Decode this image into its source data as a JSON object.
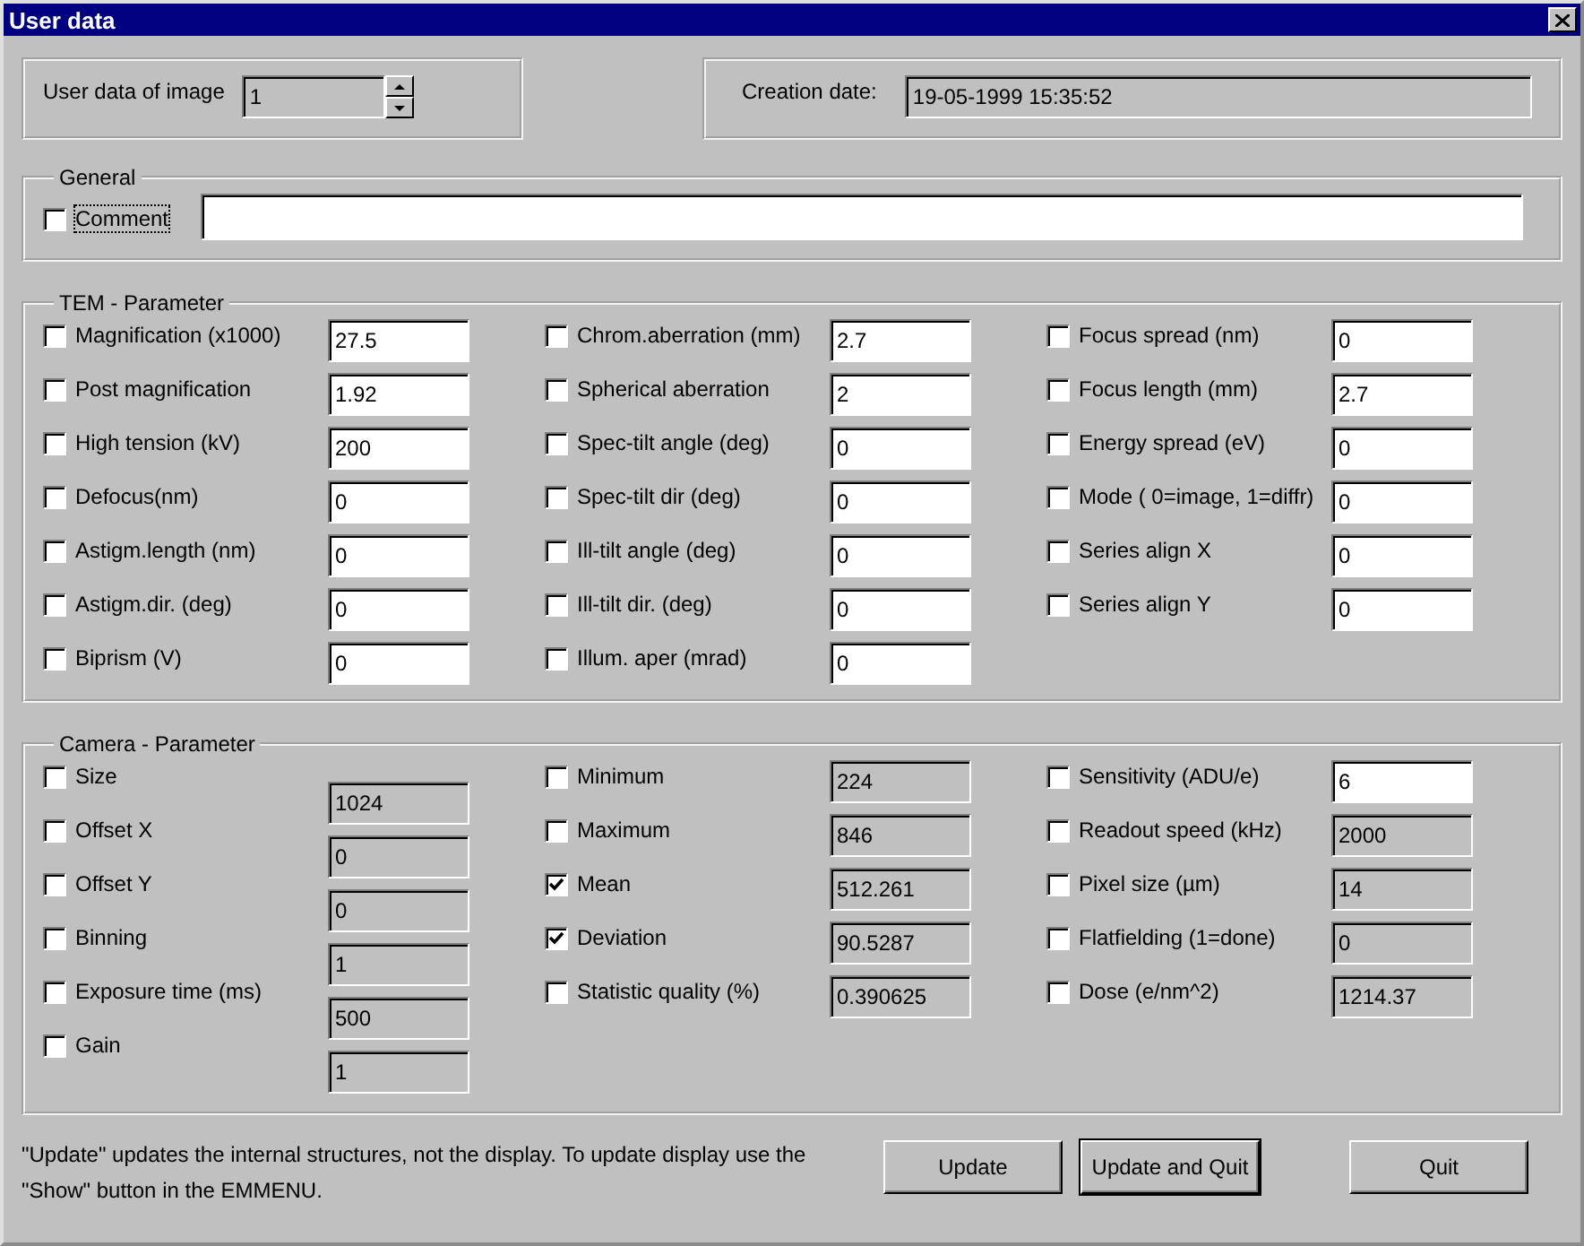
{
  "window": {
    "title": "User data"
  },
  "image_selector": {
    "label": "User data of image",
    "value": "1"
  },
  "creation": {
    "label": "Creation date:",
    "value": "19-05-1999 15:35:52"
  },
  "general": {
    "title": "General",
    "comment": {
      "label": "Comment",
      "checked": false,
      "focused": true
    }
  },
  "sections": [
    {
      "title": "TEM - Parameter",
      "columns": [
        [
          {
            "label": "Magnification (x1000)",
            "checked": false,
            "value": "27.5",
            "disabled": false
          },
          {
            "label": "Post magnification",
            "checked": false,
            "value": "1.92",
            "disabled": false
          },
          {
            "label": "High tension (kV)",
            "checked": false,
            "value": "200",
            "disabled": false
          },
          {
            "label": "Defocus(nm)",
            "checked": false,
            "value": "0",
            "disabled": false
          },
          {
            "label": "Astigm.length (nm)",
            "checked": false,
            "value": "0",
            "disabled": false
          },
          {
            "label": "Astigm.dir. (deg)",
            "checked": false,
            "value": "0",
            "disabled": false
          },
          {
            "label": "Biprism (V)",
            "checked": false,
            "value": "0",
            "disabled": false
          }
        ],
        [
          {
            "label": "Chrom.aberration (mm)",
            "checked": false,
            "value": "2.7",
            "disabled": false
          },
          {
            "label": "Spherical aberration",
            "checked": false,
            "value": "2",
            "disabled": false
          },
          {
            "label": "Spec-tilt angle (deg)",
            "checked": false,
            "value": "0",
            "disabled": false
          },
          {
            "label": "Spec-tilt dir (deg)",
            "checked": false,
            "value": "0",
            "disabled": false
          },
          {
            "label": "Ill-tilt angle (deg)",
            "checked": false,
            "value": "0",
            "disabled": false
          },
          {
            "label": "Ill-tilt dir. (deg)",
            "checked": false,
            "value": "0",
            "disabled": false
          },
          {
            "label": "Illum. aper (mrad)",
            "checked": false,
            "value": "0",
            "disabled": false
          }
        ],
        [
          {
            "label": "Focus spread (nm)",
            "checked": false,
            "value": "0",
            "disabled": false
          },
          {
            "label": "Focus length (mm)",
            "checked": false,
            "value": "2.7",
            "disabled": false
          },
          {
            "label": "Energy spread (eV)",
            "checked": false,
            "value": "0",
            "disabled": false
          },
          {
            "label": "Mode ( 0=image, 1=diffr)",
            "checked": false,
            "value": "0",
            "disabled": false
          },
          {
            "label": "Series align X",
            "checked": false,
            "value": "0",
            "disabled": false
          },
          {
            "label": "Series align Y",
            "checked": false,
            "value": "0",
            "disabled": false
          }
        ]
      ]
    },
    {
      "title": "Camera - Parameter",
      "columns": [
        [
          {
            "label": "Size",
            "checked": false,
            "value": "1024",
            "disabled": true
          },
          {
            "label": "Offset X",
            "checked": false,
            "value": "0",
            "disabled": true
          },
          {
            "label": "Offset Y",
            "checked": false,
            "value": "0",
            "disabled": true
          },
          {
            "label": "Binning",
            "checked": false,
            "value": "1",
            "disabled": true
          },
          {
            "label": "Exposure time (ms)",
            "checked": false,
            "value": "500",
            "disabled": true
          },
          {
            "label": "Gain",
            "checked": false,
            "value": "1",
            "disabled": true
          }
        ],
        [
          {
            "label": "Minimum",
            "checked": false,
            "value": "224",
            "disabled": true
          },
          {
            "label": "Maximum",
            "checked": false,
            "value": "846",
            "disabled": true
          },
          {
            "label": "Mean",
            "checked": true,
            "value": "512.261",
            "disabled": true
          },
          {
            "label": "Deviation",
            "checked": true,
            "value": "90.5287",
            "disabled": true
          },
          {
            "label": "Statistic quality (%)",
            "checked": false,
            "value": "0.390625",
            "disabled": true
          }
        ],
        [
          {
            "label": "Sensitivity (ADU/e)",
            "checked": false,
            "value": "6",
            "disabled": false
          },
          {
            "label": "Readout speed (kHz)",
            "checked": false,
            "value": "2000",
            "disabled": true
          },
          {
            "label": "Pixel size (µm)",
            "checked": false,
            "value": "14",
            "disabled": true
          },
          {
            "label": "Flatfielding (1=done)",
            "checked": false,
            "value": "0",
            "disabled": true
          },
          {
            "label": "Dose (e/nm^2)",
            "checked": false,
            "value": "1214.37",
            "disabled": true
          }
        ]
      ]
    }
  ],
  "note": "\"Update\" updates the internal structures, not the display. To update display use the \"Show\" button in the EMMENU.",
  "buttons": [
    {
      "label": "Update",
      "default": false
    },
    {
      "label": "Update and Quit",
      "default": true
    },
    {
      "label": "Quit",
      "default": false
    }
  ]
}
